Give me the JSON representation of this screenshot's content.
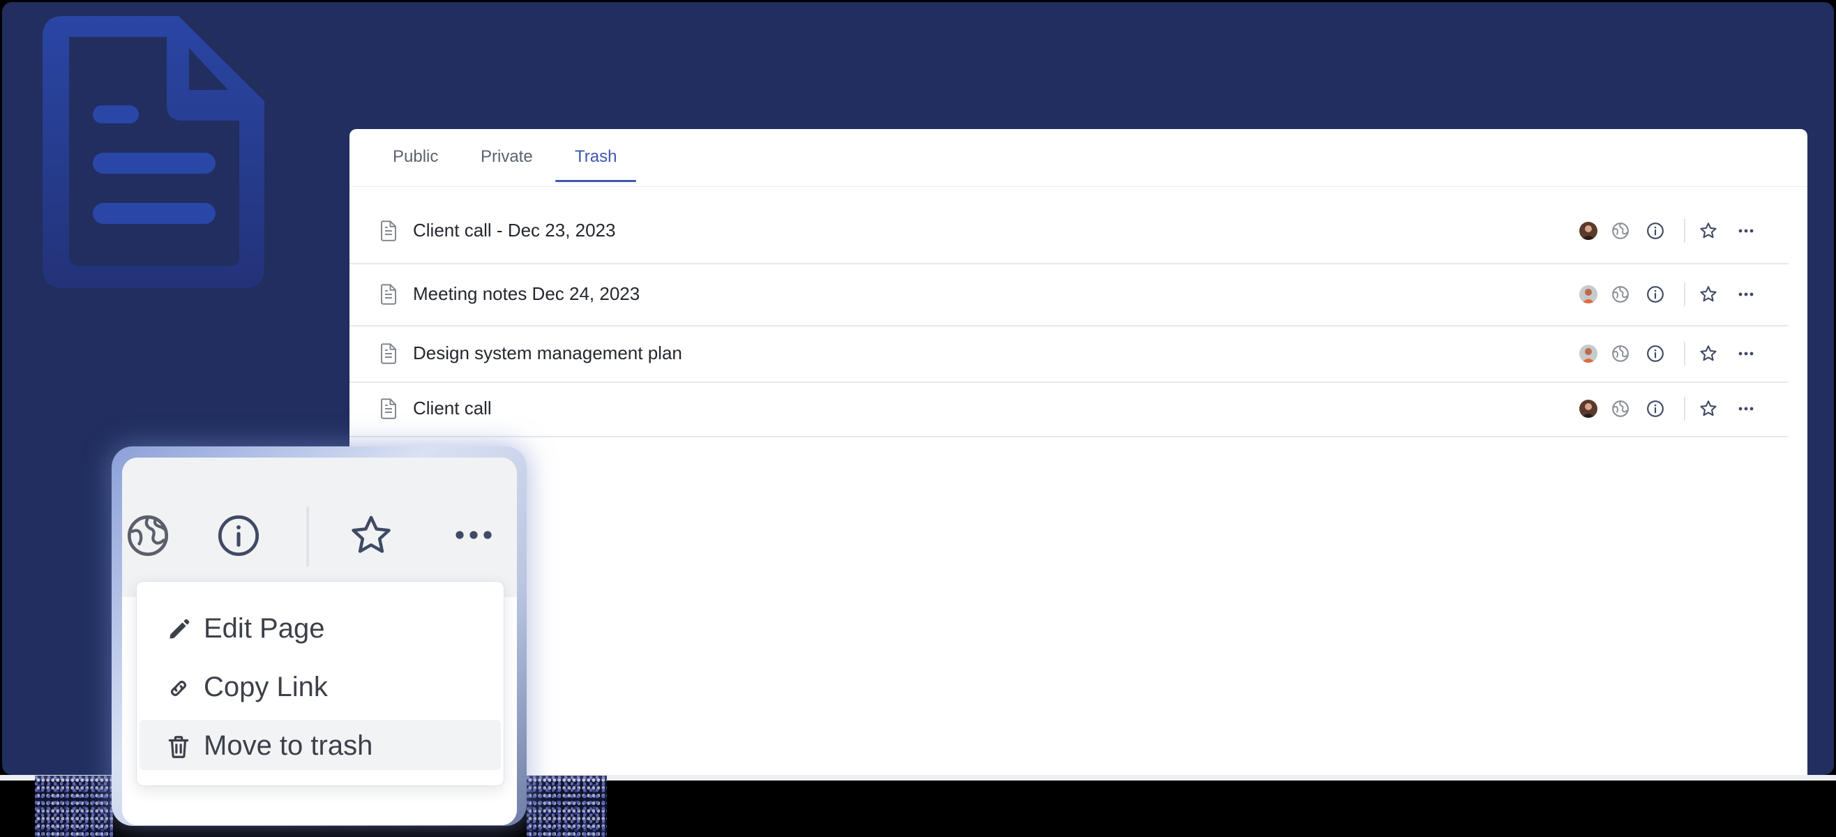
{
  "tabs": [
    {
      "label": "Public"
    },
    {
      "label": "Private"
    },
    {
      "label": "Trash"
    }
  ],
  "active_tab": "Trash",
  "pages": [
    {
      "title": "Client call - Dec 23, 2023"
    },
    {
      "title": "Meeting notes Dec 24, 2023"
    },
    {
      "title": "Design system management plan"
    },
    {
      "title": "Client call"
    }
  ],
  "menu": {
    "items": [
      {
        "label": "Edit Page",
        "icon": "pencil-icon"
      },
      {
        "label": "Copy Link",
        "icon": "link-icon"
      },
      {
        "label": "Move to trash",
        "icon": "trash-icon"
      }
    ]
  },
  "colors": {
    "frame": "#212e5f",
    "accent": "#3d56b5"
  }
}
